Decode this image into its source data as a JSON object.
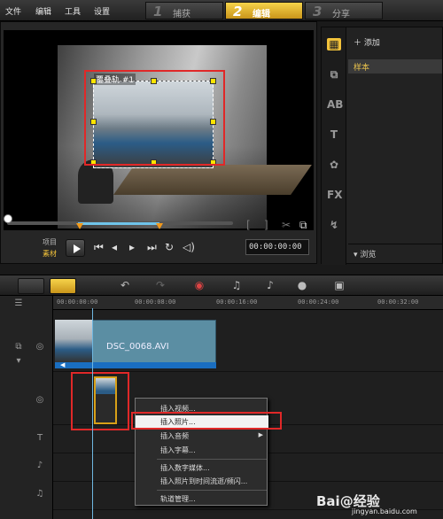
{
  "menubar": {
    "file": "文件",
    "edit": "编辑",
    "tools": "工具",
    "settings": "设置"
  },
  "steps": [
    {
      "num": "1",
      "label": "捕获"
    },
    {
      "num": "2",
      "label": "编辑"
    },
    {
      "num": "3",
      "label": "分享"
    }
  ],
  "preview": {
    "overlay_label": "覆叠轨 #1",
    "project_label": "项目",
    "clip_label": "素材",
    "timecode": "00:00:00:00"
  },
  "library": {
    "add_label": "添加",
    "sample_label": "样本",
    "browse_label": "浏览",
    "icons": [
      "media-icon",
      "transition-icon",
      "title-icon",
      "graphics-icon",
      "filter-icon",
      "path-icon"
    ]
  },
  "timeline": {
    "ruler_ticks": [
      "00:00:00:00",
      "00:00:08:00",
      "00:00:16:00",
      "00:00:24:00",
      "00:00:32:00"
    ],
    "video_clip_name": "DSC_0068.AVI"
  },
  "context_menu": {
    "items": [
      "插入视频...",
      "插入照片...",
      "插入音频",
      "插入字幕...",
      "插入数字媒体...",
      "插入照片到时间流逝/频闪...",
      "轨道管理..."
    ],
    "highlighted_index": 1
  },
  "watermark": {
    "brand": "Bai@经验",
    "url": "jingyan.baidu.com"
  },
  "colors": {
    "accent": "#f2c23a",
    "highlight_box": "#e02828",
    "clip": "#5b8ea3"
  }
}
